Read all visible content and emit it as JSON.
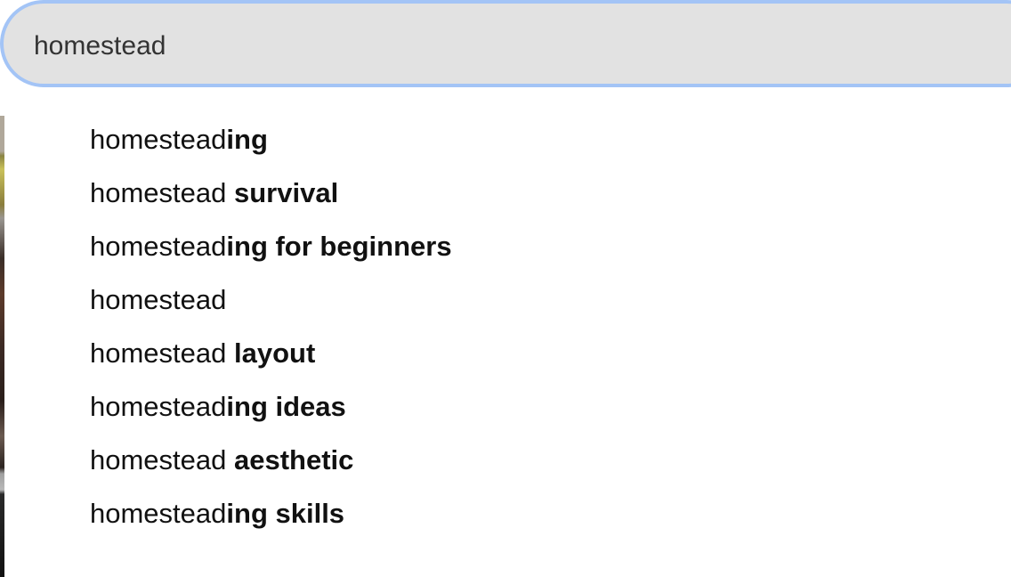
{
  "search": {
    "value": "homestead"
  },
  "suggestions": [
    {
      "base": "homestead",
      "extra": "ing"
    },
    {
      "base": "homestead ",
      "extra": "survival"
    },
    {
      "base": "homestead",
      "extra": "ing for beginners"
    },
    {
      "base": "homestead",
      "extra": ""
    },
    {
      "base": "homestead ",
      "extra": "layout"
    },
    {
      "base": "homestead",
      "extra": "ing ideas"
    },
    {
      "base": "homestead ",
      "extra": "aesthetic"
    },
    {
      "base": "homestead",
      "extra": "ing skills"
    }
  ],
  "colors": {
    "search_border": "#a3c4f6",
    "search_background": "#e2e2e2",
    "text": "#111111"
  }
}
